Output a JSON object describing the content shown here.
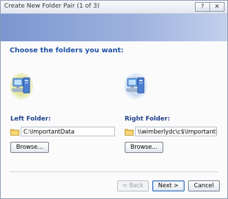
{
  "window": {
    "title": "Create New Folder Pair (1 of 3)",
    "help_label": "?",
    "close_label": "✕"
  },
  "heading": "Choose the folders you want:",
  "left": {
    "label": "Left Folder:",
    "path": "C:\\ImportantData",
    "browse_label": "Browse..."
  },
  "right": {
    "label": "Right Folder:",
    "path": "\\\\wimberlydc\\c$\\ImportantData",
    "browse_label": "Browse..."
  },
  "footer": {
    "back_label": "< Back",
    "next_label": "Next >",
    "cancel_label": "Cancel"
  },
  "colors": {
    "banner": "#8ea6d8",
    "heading": "#1f4fa6",
    "label": "#1f3f8a",
    "folder": "#f2c14e"
  },
  "icons": {
    "computer": "computer-icon",
    "folder": "folder-icon"
  }
}
